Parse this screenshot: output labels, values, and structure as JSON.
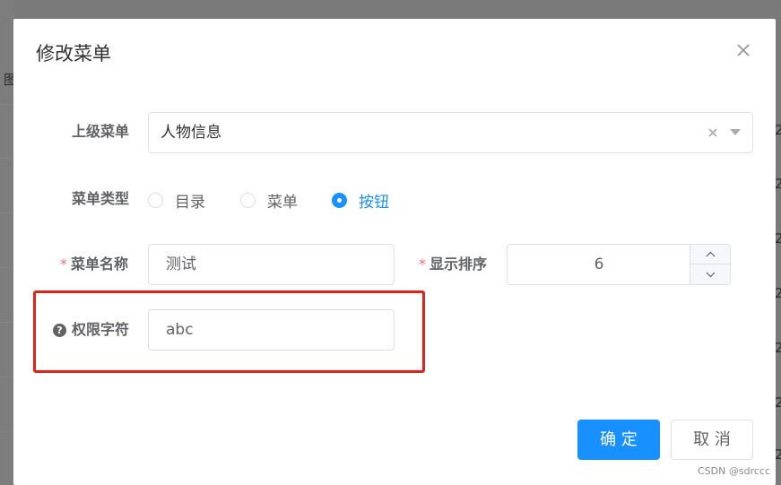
{
  "dialog": {
    "title": "修改菜单",
    "close_icon": "close-icon"
  },
  "form": {
    "parent_menu": {
      "label": "上级菜单",
      "value": "人物信息"
    },
    "menu_type": {
      "label": "菜单类型",
      "options": [
        {
          "label": "目录",
          "selected": false
        },
        {
          "label": "菜单",
          "selected": false
        },
        {
          "label": "按钮",
          "selected": true
        }
      ]
    },
    "menu_name": {
      "label": "菜单名称",
      "required_mark": "*",
      "value": "测试"
    },
    "display_order": {
      "label": "显示排序",
      "required_mark": "*",
      "value": "6"
    },
    "permission": {
      "label": "权限字符",
      "help_icon": "question-circle-icon",
      "help_glyph": "?",
      "value": "abc"
    }
  },
  "footer": {
    "confirm_label": "确 定",
    "cancel_label": "取 消"
  },
  "background": {
    "left_char": "图",
    "right_chars": [
      "2",
      "2",
      "2",
      "2",
      "2",
      "2",
      "2"
    ]
  },
  "watermark": "CSDN @sdrccc",
  "colors": {
    "primary": "#1890ff",
    "required": "#f56c6c",
    "highlight_box": "#e4221c",
    "overlay": "#7a7a7a"
  }
}
